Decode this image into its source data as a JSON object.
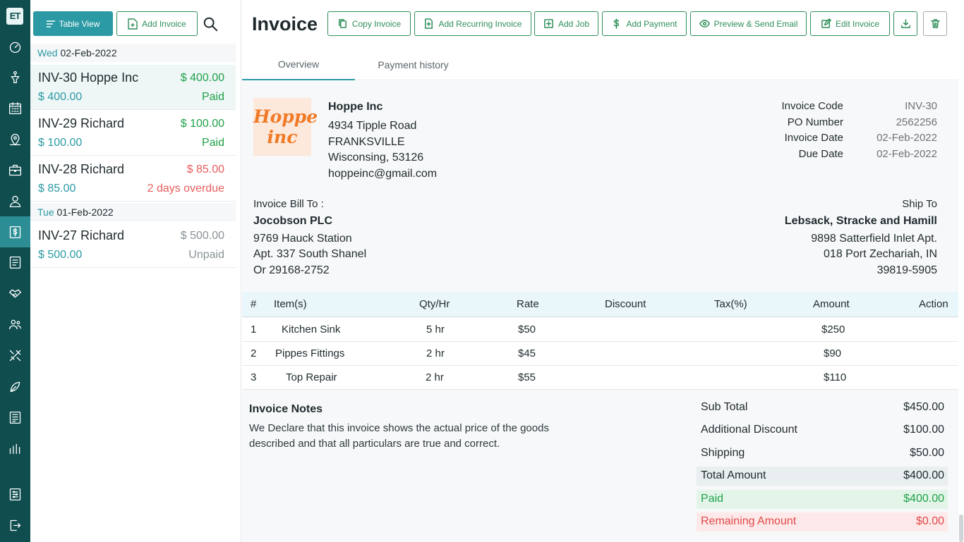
{
  "app": {
    "logo": "ET"
  },
  "rail": [
    {
      "icon": "dashboard-icon"
    },
    {
      "icon": "lead-funnel-icon"
    },
    {
      "icon": "calendar-icon"
    },
    {
      "icon": "map-pin-icon"
    },
    {
      "icon": "briefcase-icon"
    },
    {
      "icon": "user-icon"
    },
    {
      "icon": "dollar-icon",
      "active": true
    },
    {
      "icon": "document-list-icon"
    },
    {
      "icon": "handshake-icon"
    },
    {
      "icon": "team-icon"
    },
    {
      "icon": "tools-icon"
    },
    {
      "icon": "leaf-icon"
    },
    {
      "icon": "report-icon"
    },
    {
      "icon": "bar-chart-icon"
    },
    {
      "icon": "settings-sliders-icon"
    },
    {
      "icon": "logout-icon"
    }
  ],
  "list": {
    "table_view_label": "Table View",
    "add_invoice_label": "Add Invoice",
    "groups": [
      {
        "weekday": "Wed",
        "date": "02-Feb-2022"
      },
      {
        "weekday": "Tue",
        "date": "01-Feb-2022"
      }
    ],
    "items": [
      {
        "title": "INV-30 Hoppe Inc",
        "amount": "$ 400.00",
        "sub": "$ 400.00",
        "status": "Paid"
      },
      {
        "title": "INV-29 Richard",
        "amount": "$ 100.00",
        "sub": "$ 100.00",
        "status": "Paid"
      },
      {
        "title": "INV-28 Richard",
        "amount": "$ 85.00",
        "sub": "$ 85.00",
        "status": "2 days overdue"
      },
      {
        "title": "INV-27 Richard",
        "amount": "$ 500.00",
        "sub": "$ 500.00",
        "status": "Unpaid"
      }
    ]
  },
  "header": {
    "title": "Invoice",
    "actions": {
      "copy": "Copy Invoice",
      "recurring": "Add Recurring Invoice",
      "job": "Add Job",
      "payment": "Add Payment",
      "preview": "Preview & Send Email",
      "edit": "Edit Invoice"
    }
  },
  "tabs": {
    "overview": "Overview",
    "history": "Payment history"
  },
  "company": {
    "logo_text_1": "Hoppe",
    "logo_text_2": "inc",
    "name": "Hoppe Inc",
    "address1": "4934 Tipple Road",
    "city": "FRANKSVILLE",
    "state": "Wisconsing, 53126",
    "email": "hoppeinc@gmail.com"
  },
  "meta": {
    "code_label": "Invoice Code",
    "code": "INV-30",
    "po_label": "PO Number",
    "po": "2562256",
    "date_label": "Invoice Date",
    "date": "02-Feb-2022",
    "due_label": "Due Date",
    "due": "02-Feb-2022"
  },
  "bill_to": {
    "label": "Invoice Bill To :",
    "name": "Jocobson PLC",
    "line1": "9769 Hauck Station",
    "line2": "Apt. 337 South Shanel",
    "line3": "Or 29168-2752"
  },
  "ship_to": {
    "label": "Ship To",
    "name": "Lebsack, Stracke and Hamill",
    "line1": "9898 Satterfield Inlet Apt.",
    "line2": "018 Port Zechariah, IN",
    "line3": "39819-5905"
  },
  "table": {
    "headers": {
      "num": "#",
      "item": "Item(s)",
      "qty": "Qty/Hr",
      "rate": "Rate",
      "discount": "Discount",
      "tax": "Tax(%)",
      "amount": "Amount",
      "action": "Action"
    },
    "rows": [
      {
        "num": "1",
        "item": "Kitchen Sink",
        "qty": "5 hr",
        "rate": "$50",
        "amount": "$250"
      },
      {
        "num": "2",
        "item": "Pippes Fittings",
        "qty": "2 hr",
        "rate": "$45",
        "amount": "$90"
      },
      {
        "num": "3",
        "item": "Top Repair",
        "qty": "2 hr",
        "rate": "$55",
        "amount": "$110"
      }
    ]
  },
  "notes": {
    "title": "Invoice Notes",
    "text": "We Declare that this invoice shows the actual price of the goods described and that all particulars are true and correct."
  },
  "summary": {
    "subtotal_label": "Sub Total",
    "subtotal": "$450.00",
    "discount_label": "Additional Discount",
    "discount": "$100.00",
    "shipping_label": "Shipping",
    "shipping": "$50.00",
    "total_label": "Total Amount",
    "total": "$400.00",
    "paid_label": "Paid",
    "paid": "$400.00",
    "remaining_label": "Remaining Amount",
    "remaining": "$0.00"
  }
}
